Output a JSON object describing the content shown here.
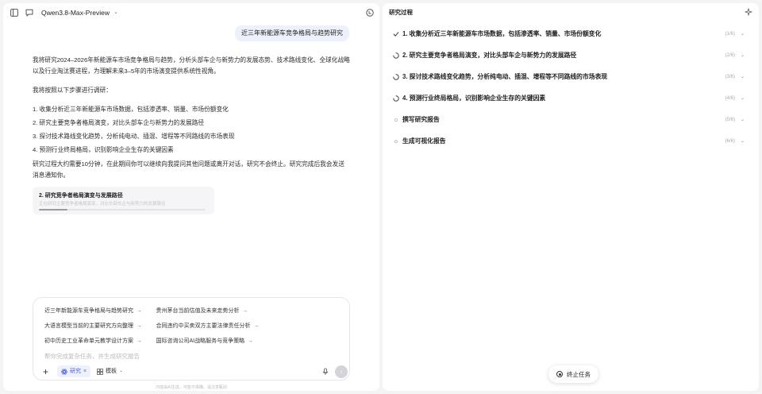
{
  "header": {
    "model_name": "Qwen3.8-Max-Preview",
    "model_caret": "⌄"
  },
  "user_message": "近三年新能源车竞争格局与趋势研究",
  "assistant": {
    "intro": "我将研究2024–2026年新能源车市场竞争格局与趋势，分析头部车企与新势力的发展态势、技术路线变化、全球化战略以及行业淘汰赛进程，为理解未来3–5年的市场演变提供系统性视角。",
    "steps_intro": "我将按照以下步骤进行调研：",
    "steps": [
      "1. 收集分析近三年新能源车市场数据，包括渗透率、销量、市场份额变化",
      "2. 研究主要竞争者格局演变，对比头部车企与新势力的发展路径",
      "3. 探讨技术路线变化趋势，分析纯电动、插混、增程等不同路线的市场表现",
      "4. 预测行业终局格局，识别影响企业生存的关键因素"
    ],
    "closing": "研究过程大约需要10分钟，在此期间你可以继续向我提问其他问题或离开对话，研究不会终止。研究完成后我会发送消息通知你。"
  },
  "progress_card": {
    "title": "2. 研究竞争者格局演变与发展路径",
    "subtitle": "正在研究主要竞争者格局演变，对比头部车企与新势力的发展路径",
    "progress": 0.17
  },
  "composer": {
    "suggestions": [
      [
        "近三年新能源车竞争格局与趋势研究",
        "贵州茅台当前估值及未来走势分析"
      ],
      [
        "大语言模型当前的主要研究方向整理",
        "合同违约中买卖双方主要法律责任分析"
      ],
      [
        "初中历史工业革命单元教学设计方案",
        "国际咨询公司AI战略服务与竞争策略"
      ]
    ],
    "suggestion_arrow": "→",
    "placeholder": "帮你完成复杂任务，并生成研究报告",
    "research_label": "研究",
    "research_close": "×",
    "template_label": "模板",
    "template_caret": "⌄",
    "send_arrow": "↑"
  },
  "footnote": "内容由AI生成，可能不准确，请注意甄别",
  "research_panel": {
    "title": "研究过程",
    "steps": [
      {
        "label": "1. 收集分析近三年新能源车市场数据，包括渗透率、销量、市场份额变化",
        "count": "(1/6)",
        "status": "done"
      },
      {
        "label": "2. 研究主要竞争者格局演变，对比头部车企与新势力的发展路径",
        "count": "(2/6)",
        "status": "running"
      },
      {
        "label": "3. 探讨技术路线变化趋势，分析纯电动、插混、增程等不同路线的市场表现",
        "count": "(3/6)",
        "status": "running"
      },
      {
        "label": "4. 预测行业终局格局，识别影响企业生存的关键因素",
        "count": "(4/6)",
        "status": "running"
      },
      {
        "label": "撰写研究报告",
        "count": "(5/6)",
        "status": "pending"
      },
      {
        "label": "生成可视化报告",
        "count": "(6/6)",
        "status": "pending"
      }
    ],
    "caret": "⌄",
    "stop_label": "终止任务"
  }
}
